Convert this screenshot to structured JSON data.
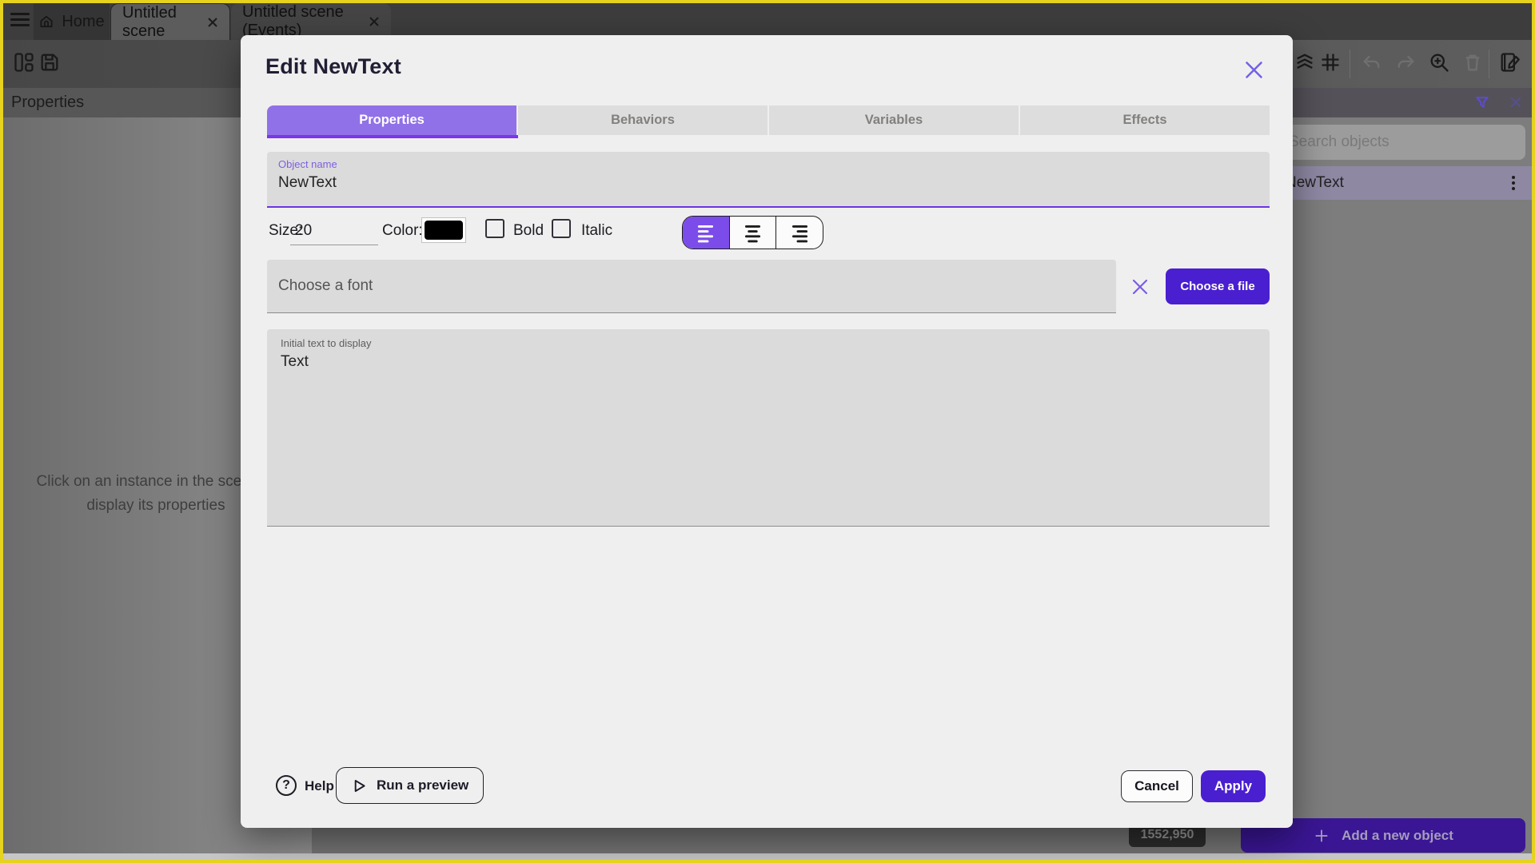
{
  "colors": {
    "accent_purple": "#7c4cea",
    "deep_purple": "#4a1fd0",
    "tab_selected_purple": "#9171e8",
    "frame_yellow": "#e5d31f",
    "text_color_swatch": "#000000"
  },
  "editor": {
    "top_tabs": [
      {
        "label": "Home"
      },
      {
        "label": "Untitled scene"
      },
      {
        "label": "Untitled scene (Events)"
      }
    ],
    "left_panel": {
      "header": "Properties",
      "empty_message_line1": "Click on an instance in the scene to",
      "empty_message_line2": "display its properties"
    },
    "right_panel": {
      "search_placeholder": "Search objects",
      "object_name": "NewText"
    },
    "statusbar": {
      "coordinates": "1552,950",
      "add_object_label": "Add a new object"
    }
  },
  "dialog": {
    "title": "Edit NewText",
    "tabs": [
      {
        "label": "Properties",
        "selected": true
      },
      {
        "label": "Behaviors",
        "selected": false
      },
      {
        "label": "Variables",
        "selected": false
      },
      {
        "label": "Effects",
        "selected": false
      }
    ],
    "object_name": {
      "label": "Object name",
      "value": "NewText"
    },
    "size": {
      "label": "Size:",
      "value": "20"
    },
    "color": {
      "label": "Color:",
      "value": "#000000"
    },
    "bold": {
      "label": "Bold",
      "checked": false
    },
    "italic": {
      "label": "Italic",
      "checked": false
    },
    "alignment": "left",
    "font_field": {
      "placeholder": "Choose a font"
    },
    "choose_file_label": "Choose a file",
    "initial_text": {
      "label": "Initial text to display",
      "value": "Text"
    },
    "footer": {
      "help_glyph": "?",
      "help_label": "Help",
      "run_preview_label": "Run a preview",
      "cancel_label": "Cancel",
      "apply_label": "Apply"
    }
  }
}
